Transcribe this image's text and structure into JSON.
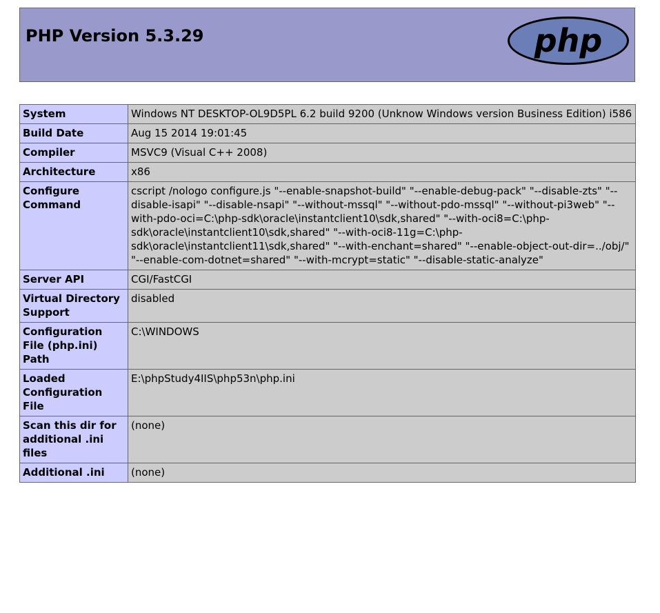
{
  "header": {
    "title": "PHP Version 5.3.29",
    "logo_text": "php"
  },
  "rows": [
    {
      "label": "System",
      "value": "Windows NT DESKTOP-OL9D5PL 6.2 build 9200 (Unknow Windows version Business Edition) i586"
    },
    {
      "label": "Build Date",
      "value": "Aug 15 2014 19:01:45"
    },
    {
      "label": "Compiler",
      "value": "MSVC9 (Visual C++ 2008)"
    },
    {
      "label": "Architecture",
      "value": "x86"
    },
    {
      "label": "Configure Command",
      "value": "cscript /nologo configure.js \"--enable-snapshot-build\" \"--enable-debug-pack\" \"--disable-zts\" \"--disable-isapi\" \"--disable-nsapi\" \"--without-mssql\" \"--without-pdo-mssql\" \"--without-pi3web\" \"--with-pdo-oci=C:\\php-sdk\\oracle\\instantclient10\\sdk,shared\" \"--with-oci8=C:\\php-sdk\\oracle\\instantclient10\\sdk,shared\" \"--with-oci8-11g=C:\\php-sdk\\oracle\\instantclient11\\sdk,shared\" \"--with-enchant=shared\" \"--enable-object-out-dir=../obj/\" \"--enable-com-dotnet=shared\" \"--with-mcrypt=static\" \"--disable-static-analyze\""
    },
    {
      "label": "Server API",
      "value": "CGI/FastCGI"
    },
    {
      "label": "Virtual Directory Support",
      "value": "disabled"
    },
    {
      "label": "Configuration File (php.ini) Path",
      "value": "C:\\WINDOWS"
    },
    {
      "label": "Loaded Configuration File",
      "value": "E:\\phpStudy4IIS\\php53n\\php.ini"
    },
    {
      "label": "Scan this dir for additional .ini files",
      "value": "(none)"
    },
    {
      "label": "Additional .ini",
      "value": "(none)"
    }
  ],
  "colors": {
    "header_bg": "#9999cc",
    "label_bg": "#ccccff",
    "value_bg": "#cccccc",
    "border": "#666666",
    "logo_fill": "#6c7eb7",
    "logo_text": "#000000"
  }
}
